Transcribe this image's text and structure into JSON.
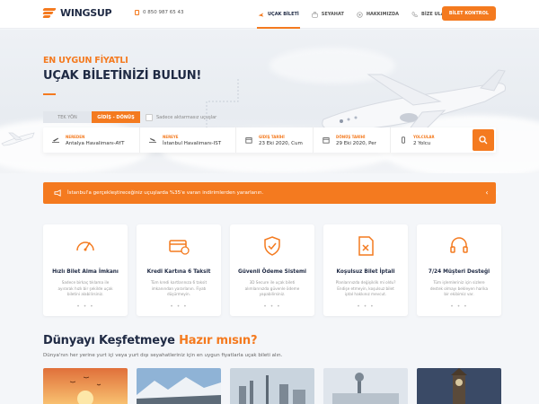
{
  "brand": {
    "name": "WINGSUP",
    "phone": "0 850 987 65 43",
    "accent": "#f47a1f",
    "navy": "#1f2a44"
  },
  "nav": {
    "items": [
      {
        "label": "UÇAK BİLETİ",
        "icon": "plane-icon",
        "active": true
      },
      {
        "label": "SEYAHAT",
        "icon": "suitcase-icon",
        "active": false
      },
      {
        "label": "HAKKIMIZDA",
        "icon": "info-icon",
        "active": false
      },
      {
        "label": "BİZE ULAŞIN",
        "icon": "phone-icon",
        "active": false
      }
    ],
    "cta": "BİLET KONTROL"
  },
  "hero": {
    "tagline_small": "EN UYGUN FİYATLI",
    "tagline_big": "UÇAK BİLETİNİZİ BULUN!"
  },
  "search": {
    "tabs": [
      {
        "label": "TEK YÖN",
        "active": false
      },
      {
        "label": "GİDİŞ - DÖNÜŞ",
        "active": true
      }
    ],
    "direct_only": "Sadece aktarmasız uçuşlar",
    "fields": [
      {
        "label": "NEREDEN",
        "value": "Antalya Havalimanı-AYT",
        "icon": "takeoff-icon"
      },
      {
        "label": "NEREYE",
        "value": "İstanbul Havalimanı-IST",
        "icon": "landing-icon"
      },
      {
        "label": "GİDİŞ TARİHİ",
        "value": "23 Eki 2020, Cum",
        "icon": "calendar-icon"
      },
      {
        "label": "DÖNÜŞ TARİHİ",
        "value": "29 Eki 2020, Per",
        "icon": "calendar-icon"
      },
      {
        "label": "YOLCULAR",
        "value": "2 Yolcu",
        "icon": "passenger-icon"
      }
    ],
    "search_icon": "search-icon"
  },
  "promo": {
    "text": "İstanbul'a gerçekleştireceğiniz uçuşlarda %35'e varan indirimlerden yararlanın."
  },
  "features": [
    {
      "title": "Hızlı Bilet Alma İmkanı",
      "desc": "Sadece birkaç tıklama ile ayırarak hızlı bir şekilde uçak biletini alabilirsiniz.",
      "icon": "speedometer-icon"
    },
    {
      "title": "Kredi Kartına 6 Taksit",
      "desc": "Tüm kredi kartlarınıza 6 taksit imkanından yararlanın. Fiyatı düşürmeyin.",
      "icon": "credit-card-icon"
    },
    {
      "title": "Güvenli Ödeme Sistemi",
      "desc": "3D Secure ile uçak bileti alımlarınızda güvenle ödeme yapabilirsiniz.",
      "icon": "shield-check-icon"
    },
    {
      "title": "Koşulsuz Bilet İptali",
      "desc": "Planlarınızda değişiklik mi oldu? Endişe etmeyin, koşulsuz bilet iptal hakkınız mevcut.",
      "icon": "ticket-cancel-icon"
    },
    {
      "title": "7/24 Müşteri Desteği",
      "desc": "Tüm işlemleriniz için sizlere destek olmayı bekleyen harika bir ekibimiz var.",
      "icon": "headset-icon"
    }
  ],
  "explore": {
    "title_main": "Dünyayı Keşfetmeye",
    "title_accent": "Hazır mısın?",
    "subtitle": "Dünya'nın her yerine yurt içi veya yurt dışı seyahatleriniz için en uygun fiyatlarla uçak bileti alın."
  }
}
